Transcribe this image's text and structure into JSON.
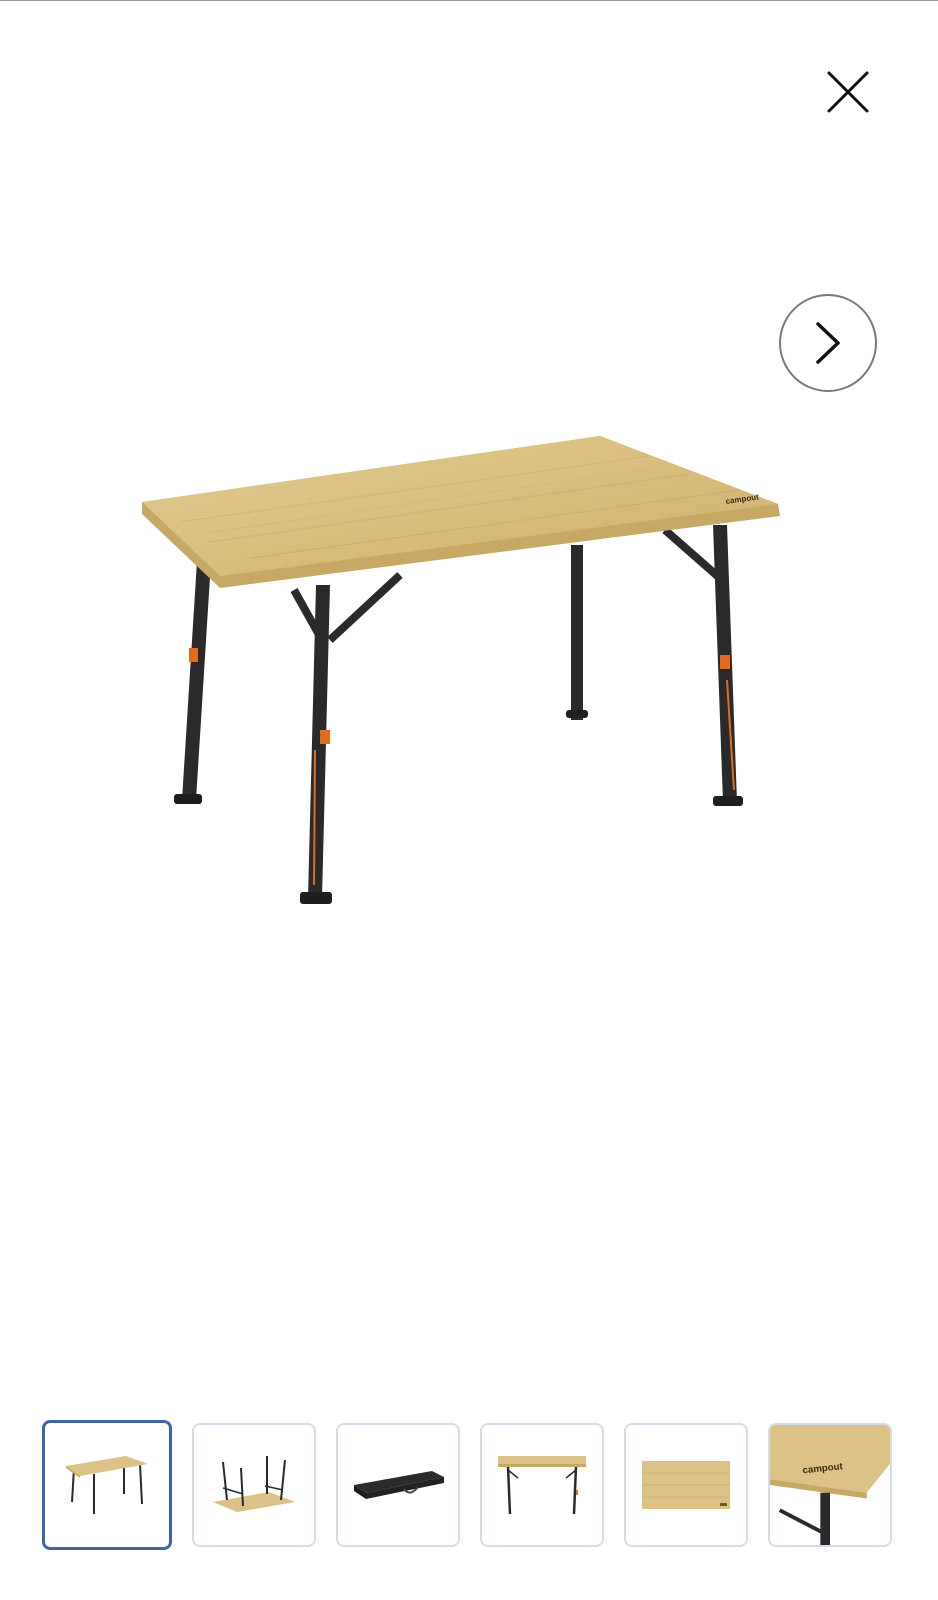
{
  "viewer": {
    "close_icon": "close-icon",
    "next_icon": "chevron-right-icon",
    "brand_text": "campout"
  },
  "thumbnails": [
    {
      "name": "thumb-table-standing",
      "selected": true
    },
    {
      "name": "thumb-table-upside-down",
      "selected": false
    },
    {
      "name": "thumb-carry-bag",
      "selected": false
    },
    {
      "name": "thumb-table-side-view",
      "selected": false
    },
    {
      "name": "thumb-tabletop",
      "selected": false
    },
    {
      "name": "thumb-corner-detail",
      "selected": false
    }
  ],
  "colors": {
    "selected_border": "#3d64ad",
    "thumb_border": "#d3dcea",
    "bamboo": "#dcc286",
    "frame": "#2a2a2c",
    "accent": "#e36b1c"
  }
}
